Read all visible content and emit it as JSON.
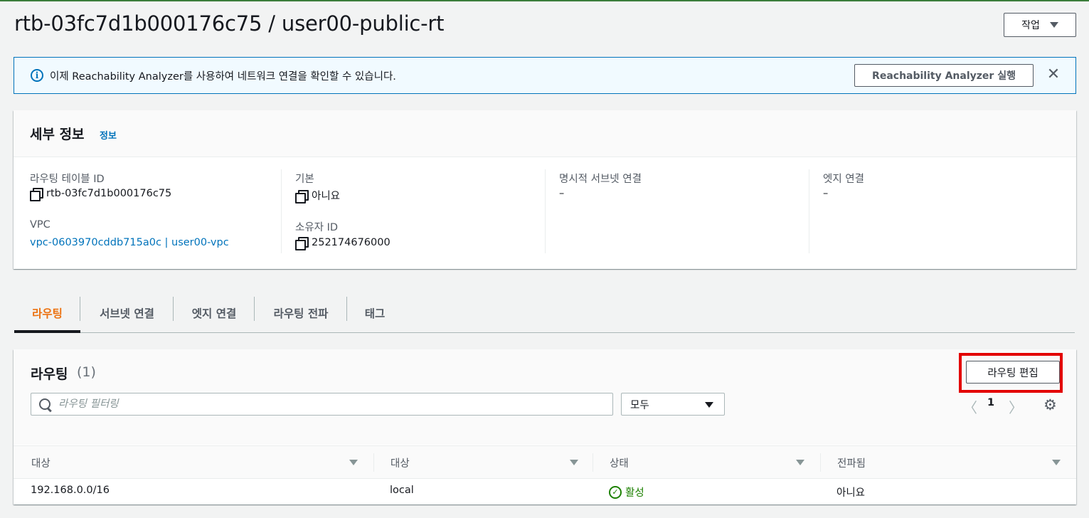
{
  "header": {
    "title": "rtb-03fc7d1b000176c75 / user00-public-rt",
    "actions_label": "작업"
  },
  "banner": {
    "message": "이제 Reachability Analyzer를 사용하여 네트워크 연결을 확인할 수 있습니다.",
    "button_label": "Reachability Analyzer 실행",
    "close_glyph": "✕",
    "info_glyph": "i"
  },
  "details": {
    "title": "세부 정보",
    "info_link": "정보",
    "route_table_id_label": "라우팅 테이블 ID",
    "route_table_id": "rtb-03fc7d1b000176c75",
    "main_label": "기본",
    "main_value": "아니요",
    "explicit_subnet_label": "명시적 서브넷 연결",
    "explicit_subnet_value": "–",
    "edge_label": "엣지 연결",
    "edge_value": "–",
    "vpc_label": "VPC",
    "vpc_value": "vpc-0603970cddb715a0c | user00-vpc",
    "owner_label": "소유자 ID",
    "owner_value": "252174676000"
  },
  "tabs": [
    {
      "label": "라우팅",
      "active": true
    },
    {
      "label": "서브넷 연결",
      "active": false
    },
    {
      "label": "엣지 연결",
      "active": false
    },
    {
      "label": "라우팅 전파",
      "active": false
    },
    {
      "label": "태그",
      "active": false
    }
  ],
  "routes": {
    "title": "라우팅",
    "count": "(1)",
    "edit_button": "라우팅 편집",
    "search_placeholder": "라우팅 필터링",
    "filter_select": "모두",
    "pager_prev": "〈",
    "page": "1",
    "pager_next": "〉",
    "settings_glyph": "⚙",
    "columns": [
      "대상",
      "대상",
      "상태",
      "전파됨"
    ],
    "rows": [
      {
        "destination": "192.168.0.0/16",
        "target": "local",
        "status": "활성",
        "propagated": "아니요"
      }
    ]
  },
  "colors": {
    "accent": "#ec7211",
    "link": "#0073bb",
    "success": "#1d8102",
    "highlight": "#e30000"
  }
}
